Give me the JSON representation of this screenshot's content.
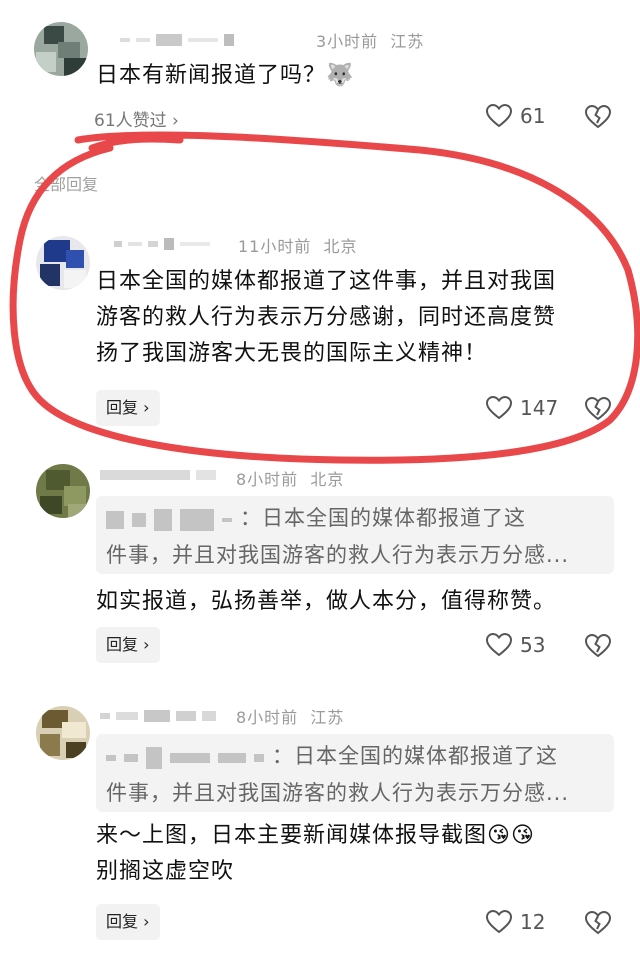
{
  "comments": [
    {
      "time": "3小时前",
      "location": "江苏",
      "text": "日本有新闻报道了吗？",
      "emoji": "🐺",
      "likers_label": "61人赞过 ›",
      "likes": "61"
    }
  ],
  "section_label": "全部回复",
  "replies": [
    {
      "time": "11小时前",
      "location": "北京",
      "text_lines": [
        "日本全国的媒体都报道了这件事，并且对我国",
        "游客的救人行为表示万分感谢，同时还高度赞",
        "扬了我国游客大无畏的国际主义精神！"
      ],
      "reply_label": "回复 ›",
      "likes": "147"
    },
    {
      "time": "8小时前",
      "location": "北京",
      "quote_lines": [
        "：日本全国的媒体都报道了这",
        "件事，并且对我国游客的救人行为表示万分感..."
      ],
      "text": "如实报道，弘扬善举，做人本分，值得称赞。",
      "reply_label": "回复 ›",
      "likes": "53"
    },
    {
      "time": "8小时前",
      "location": "江苏",
      "quote_lines": [
        "：日本全国的媒体都报道了这",
        "件事，并且对我国游客的救人行为表示万分感..."
      ],
      "text_lines": [
        "来～上图，日本主要新闻媒体报导截图",
        "别搁这虚空吹"
      ],
      "emoji": "😘😘",
      "reply_label": "回复 ›",
      "likes": "12"
    }
  ],
  "colors": {
    "annotation_loop": "#e8484a",
    "meta_text": "#9a9a9a",
    "reply_button_bg": "#f2f2f2",
    "quote_bg": "#f3f3f3"
  },
  "icons": [
    "heart-icon",
    "broken-heart-icon",
    "chevron-right-icon"
  ]
}
